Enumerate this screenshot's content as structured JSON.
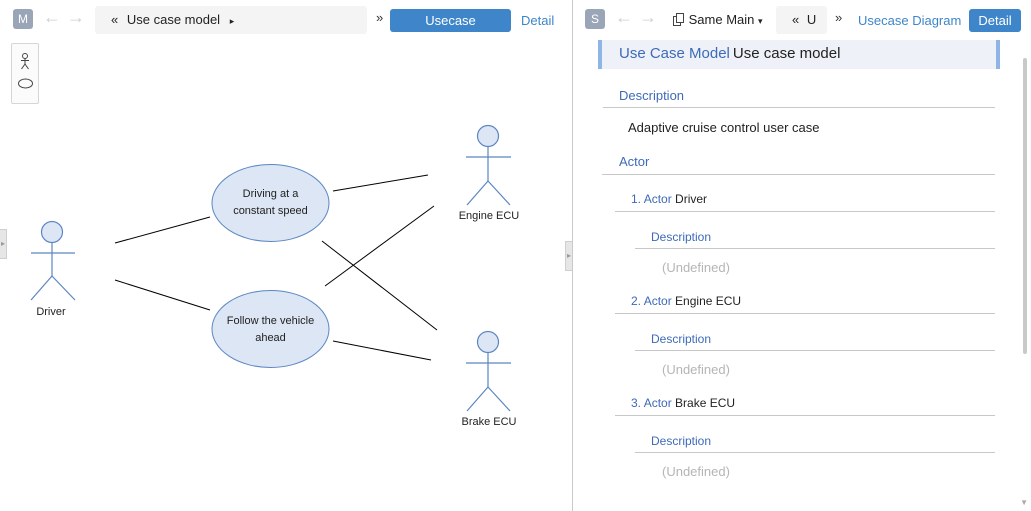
{
  "left": {
    "badge": "M",
    "back_arrow": "←",
    "forward_arrow": "→",
    "breadcrumb": {
      "prefix": "«",
      "label": "Use case model",
      "suffix": "▸"
    },
    "more": "»",
    "active_tab": "Usecase Diagram",
    "detail_link": "Detail",
    "palette": {
      "items": [
        "actor-tool-icon",
        "usecase-tool-icon"
      ]
    },
    "diagram": {
      "actors": [
        {
          "name": "Driver"
        },
        {
          "name": "Engine ECU"
        },
        {
          "name": "Brake ECU"
        }
      ],
      "usecases": [
        {
          "line1": "Driving at a",
          "line2": "constant speed"
        },
        {
          "line1": "Follow the vehicle",
          "line2": "ahead"
        }
      ]
    }
  },
  "right": {
    "badge": "S",
    "back_arrow": "←",
    "forward_arrow": "→",
    "same_main": {
      "icon": "copy-icon",
      "label": "Same Main",
      "caret": "▾"
    },
    "breadcrumb": {
      "prefix": "«",
      "label": "U"
    },
    "more": "»",
    "usecase_link": "Usecase Diagram",
    "active_tab": "Detail",
    "header": {
      "kind": "Use Case Model",
      "value": "Use case model"
    },
    "description_label": "Description",
    "description_value": "Adaptive cruise control user case",
    "actor_label": "Actor",
    "actors": [
      {
        "num": "1.",
        "kind": "Actor",
        "name": "Driver",
        "desc_label": "Description",
        "desc_value": "(Undefined)"
      },
      {
        "num": "2.",
        "kind": "Actor",
        "name": "Engine ECU",
        "desc_label": "Description",
        "desc_value": "(Undefined)"
      },
      {
        "num": "3.",
        "kind": "Actor",
        "name": "Brake ECU",
        "desc_label": "Description",
        "desc_value": "(Undefined)"
      }
    ]
  },
  "colors": {
    "accent": "#3e86c9",
    "link_text": "#3e6ab8",
    "usecase_fill": "#dce6f4",
    "shape_stroke": "#5b86c2"
  }
}
